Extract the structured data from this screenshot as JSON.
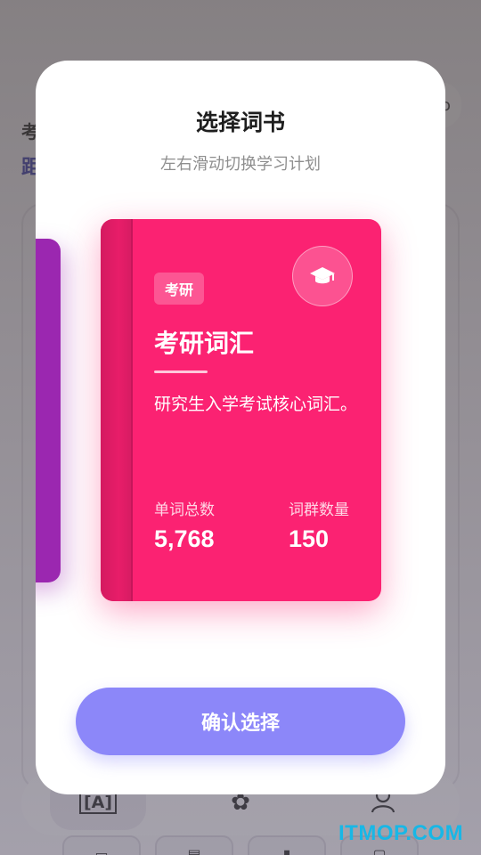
{
  "background": {
    "text_line1": "考",
    "text_line2": "距",
    "right_button_glyph": "ɔ",
    "nav": [
      {
        "icon": "book-reader-icon",
        "glyph": "[A]"
      },
      {
        "icon": "flower-icon",
        "glyph": "✿"
      },
      {
        "icon": "person-icon",
        "glyph": "◯"
      }
    ]
  },
  "modal": {
    "title": "选择词书",
    "subtitle": "左右滑动切换学习计划",
    "confirm_label": "确认选择"
  },
  "card": {
    "tag": "考研",
    "name": "考研词汇",
    "description": "研究生入学考试核心词汇。",
    "icon": "graduation-cap-icon",
    "color": "#fb2272",
    "stats": [
      {
        "label": "单词总数",
        "value": "5,768"
      },
      {
        "label": "词群数量",
        "value": "150"
      }
    ]
  },
  "prev_card": {
    "color": "#9b27b0"
  },
  "accent": "#8c87f9",
  "watermark": "ITMOP.COM"
}
